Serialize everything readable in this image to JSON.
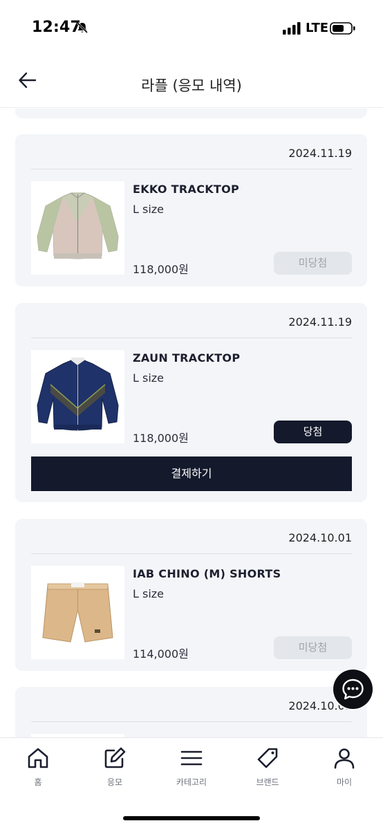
{
  "status_bar": {
    "time": "12:47",
    "network": "LTE"
  },
  "header": {
    "title": "라플 (응모 내역)"
  },
  "entries": [
    {
      "date": "2024.11.19",
      "name": "EKKO TRACKTOP",
      "size": "L size",
      "price": "118,000원",
      "status": "미당첨",
      "result": "lose"
    },
    {
      "date": "2024.11.19",
      "name": "ZAUN TRACKTOP",
      "size": "L size",
      "price": "118,000원",
      "status": "당첨",
      "result": "win",
      "pay_label": "결제하기"
    },
    {
      "date": "2024.10.01",
      "name": "IAB CHINO (M) SHORTS",
      "size": "L size",
      "price": "114,000원",
      "status": "미당첨",
      "result": "lose"
    },
    {
      "date": "2024.10.01"
    }
  ],
  "bottom_nav": [
    {
      "label": "홈",
      "icon": "home-icon"
    },
    {
      "label": "응모",
      "icon": "edit-icon"
    },
    {
      "label": "카테고리",
      "icon": "menu-icon"
    },
    {
      "label": "브랜드",
      "icon": "tag-icon"
    },
    {
      "label": "마이",
      "icon": "user-icon"
    }
  ],
  "colors": {
    "card_bg": "#f3f5f8",
    "primary_dark": "#141a2c",
    "disabled_bg": "#e3e6ea",
    "disabled_text": "#9ea3ab"
  }
}
